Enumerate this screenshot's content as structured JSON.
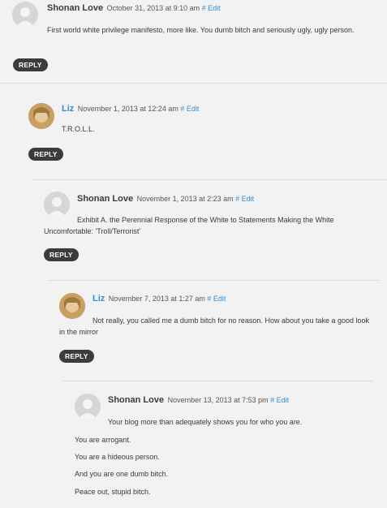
{
  "comments": [
    {
      "author": "Shonan Love",
      "date": "October 31, 2013 at 9:10 am",
      "edit": "# Edit",
      "text": "First world white privilege manifesto, more like. You dumb bitch and seriously ugly, ugly person.",
      "reply": "REPLY"
    },
    {
      "author": "Liz",
      "date": "November 1, 2013 at 12:24 am",
      "edit": "# Edit",
      "text": "T.R.O.L.L.",
      "reply": "REPLY"
    },
    {
      "author": "Shonan Love",
      "date": "November 1, 2013 at 2:23 am",
      "edit": "# Edit",
      "text": "Exhibit A. the Perennial Response of the White to Statements Making the White Uncomfortable: 'Troll/Terrorist'",
      "reply": "REPLY"
    },
    {
      "author": "Liz",
      "date": "November 7, 2013 at 1:27 am",
      "edit": "# Edit",
      "text": "Not really, you called me a dumb bitch for no reason. How about you take a good look in the mirror",
      "reply": "REPLY"
    },
    {
      "author": "Shonan Love",
      "date": "November 13, 2013 at 7:53 pm",
      "edit": "# Edit",
      "text": "Your blog more than adequately shows you for who you are.",
      "paragraphs": [
        "You are arrogant.",
        "You are a hideous person.",
        "And you are one dumb bitch.",
        "Peace out, stupid bitch."
      ]
    }
  ]
}
